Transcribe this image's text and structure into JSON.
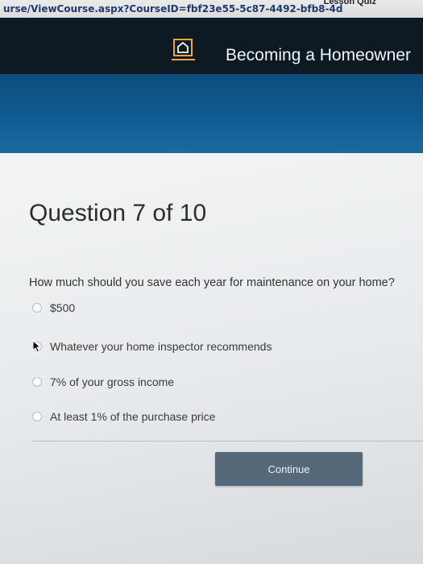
{
  "browser": {
    "url": "urse/ViewCourse.aspx?CourseID=fbf23e55-5c87-4492-bfb8-4d",
    "breadcrumb": "Lesson Quiz"
  },
  "header": {
    "logo_icon": "house-icon",
    "accent_color": "#f2a33a",
    "title": "Becoming a Homeowner"
  },
  "quiz": {
    "heading": "Question 7 of 10",
    "question": "How much should you save each year for maintenance on your home?",
    "options": [
      "$500",
      "Whatever your home inspector recommends",
      "7% of your gross income",
      "At least 1% of the purchase price"
    ],
    "continue_label": "Continue"
  }
}
